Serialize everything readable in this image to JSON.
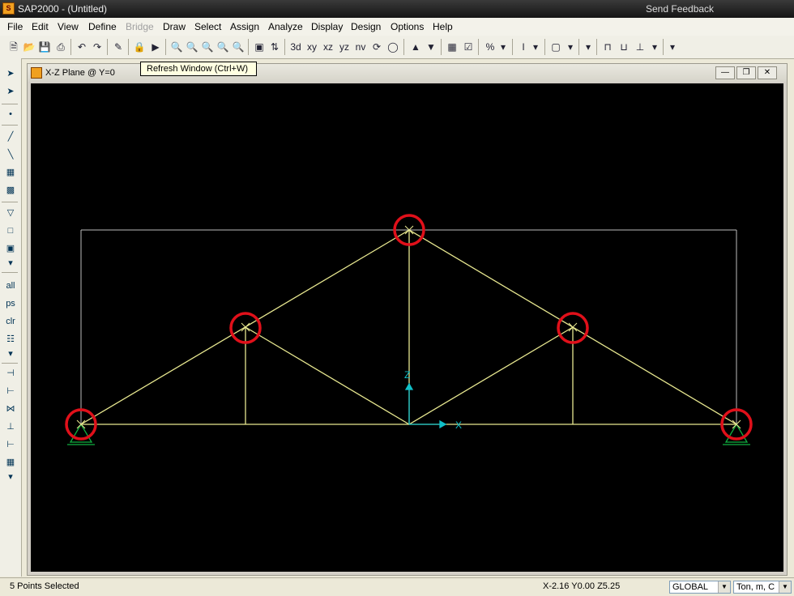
{
  "app": {
    "title": "SAP2000 - (Untitled)",
    "feedback": "Send Feedback",
    "icon_name": "sap-app-icon"
  },
  "menus": [
    "File",
    "Edit",
    "View",
    "Define",
    "Bridge",
    "Draw",
    "Select",
    "Assign",
    "Analyze",
    "Display",
    "Design",
    "Options",
    "Help"
  ],
  "disabled_menus": [
    "Bridge"
  ],
  "toolbar": {
    "view_3d": "3d",
    "view_xy": "xy",
    "view_xz": "xz",
    "view_yz": "yz",
    "view_nv": "nv"
  },
  "sidebar": {
    "select_all": "all",
    "previous": "ps",
    "clear": "clr"
  },
  "tooltip": "Refresh Window (Ctrl+W)",
  "view_window": {
    "title": "X-Z Plane @ Y=0"
  },
  "truss": {
    "axis_x": "X",
    "axis_z": "Z",
    "colors": {
      "frame": "#e8e890",
      "grid": "#bdbdbd",
      "selection": "#e0101a",
      "axis": "#10c0c8",
      "support": "#10b040"
    }
  },
  "status": {
    "selection": "5 Points Selected",
    "coords": "X-2.16  Y0.00  Z5.25",
    "coord_system": "GLOBAL",
    "units": "Ton, m, C"
  }
}
